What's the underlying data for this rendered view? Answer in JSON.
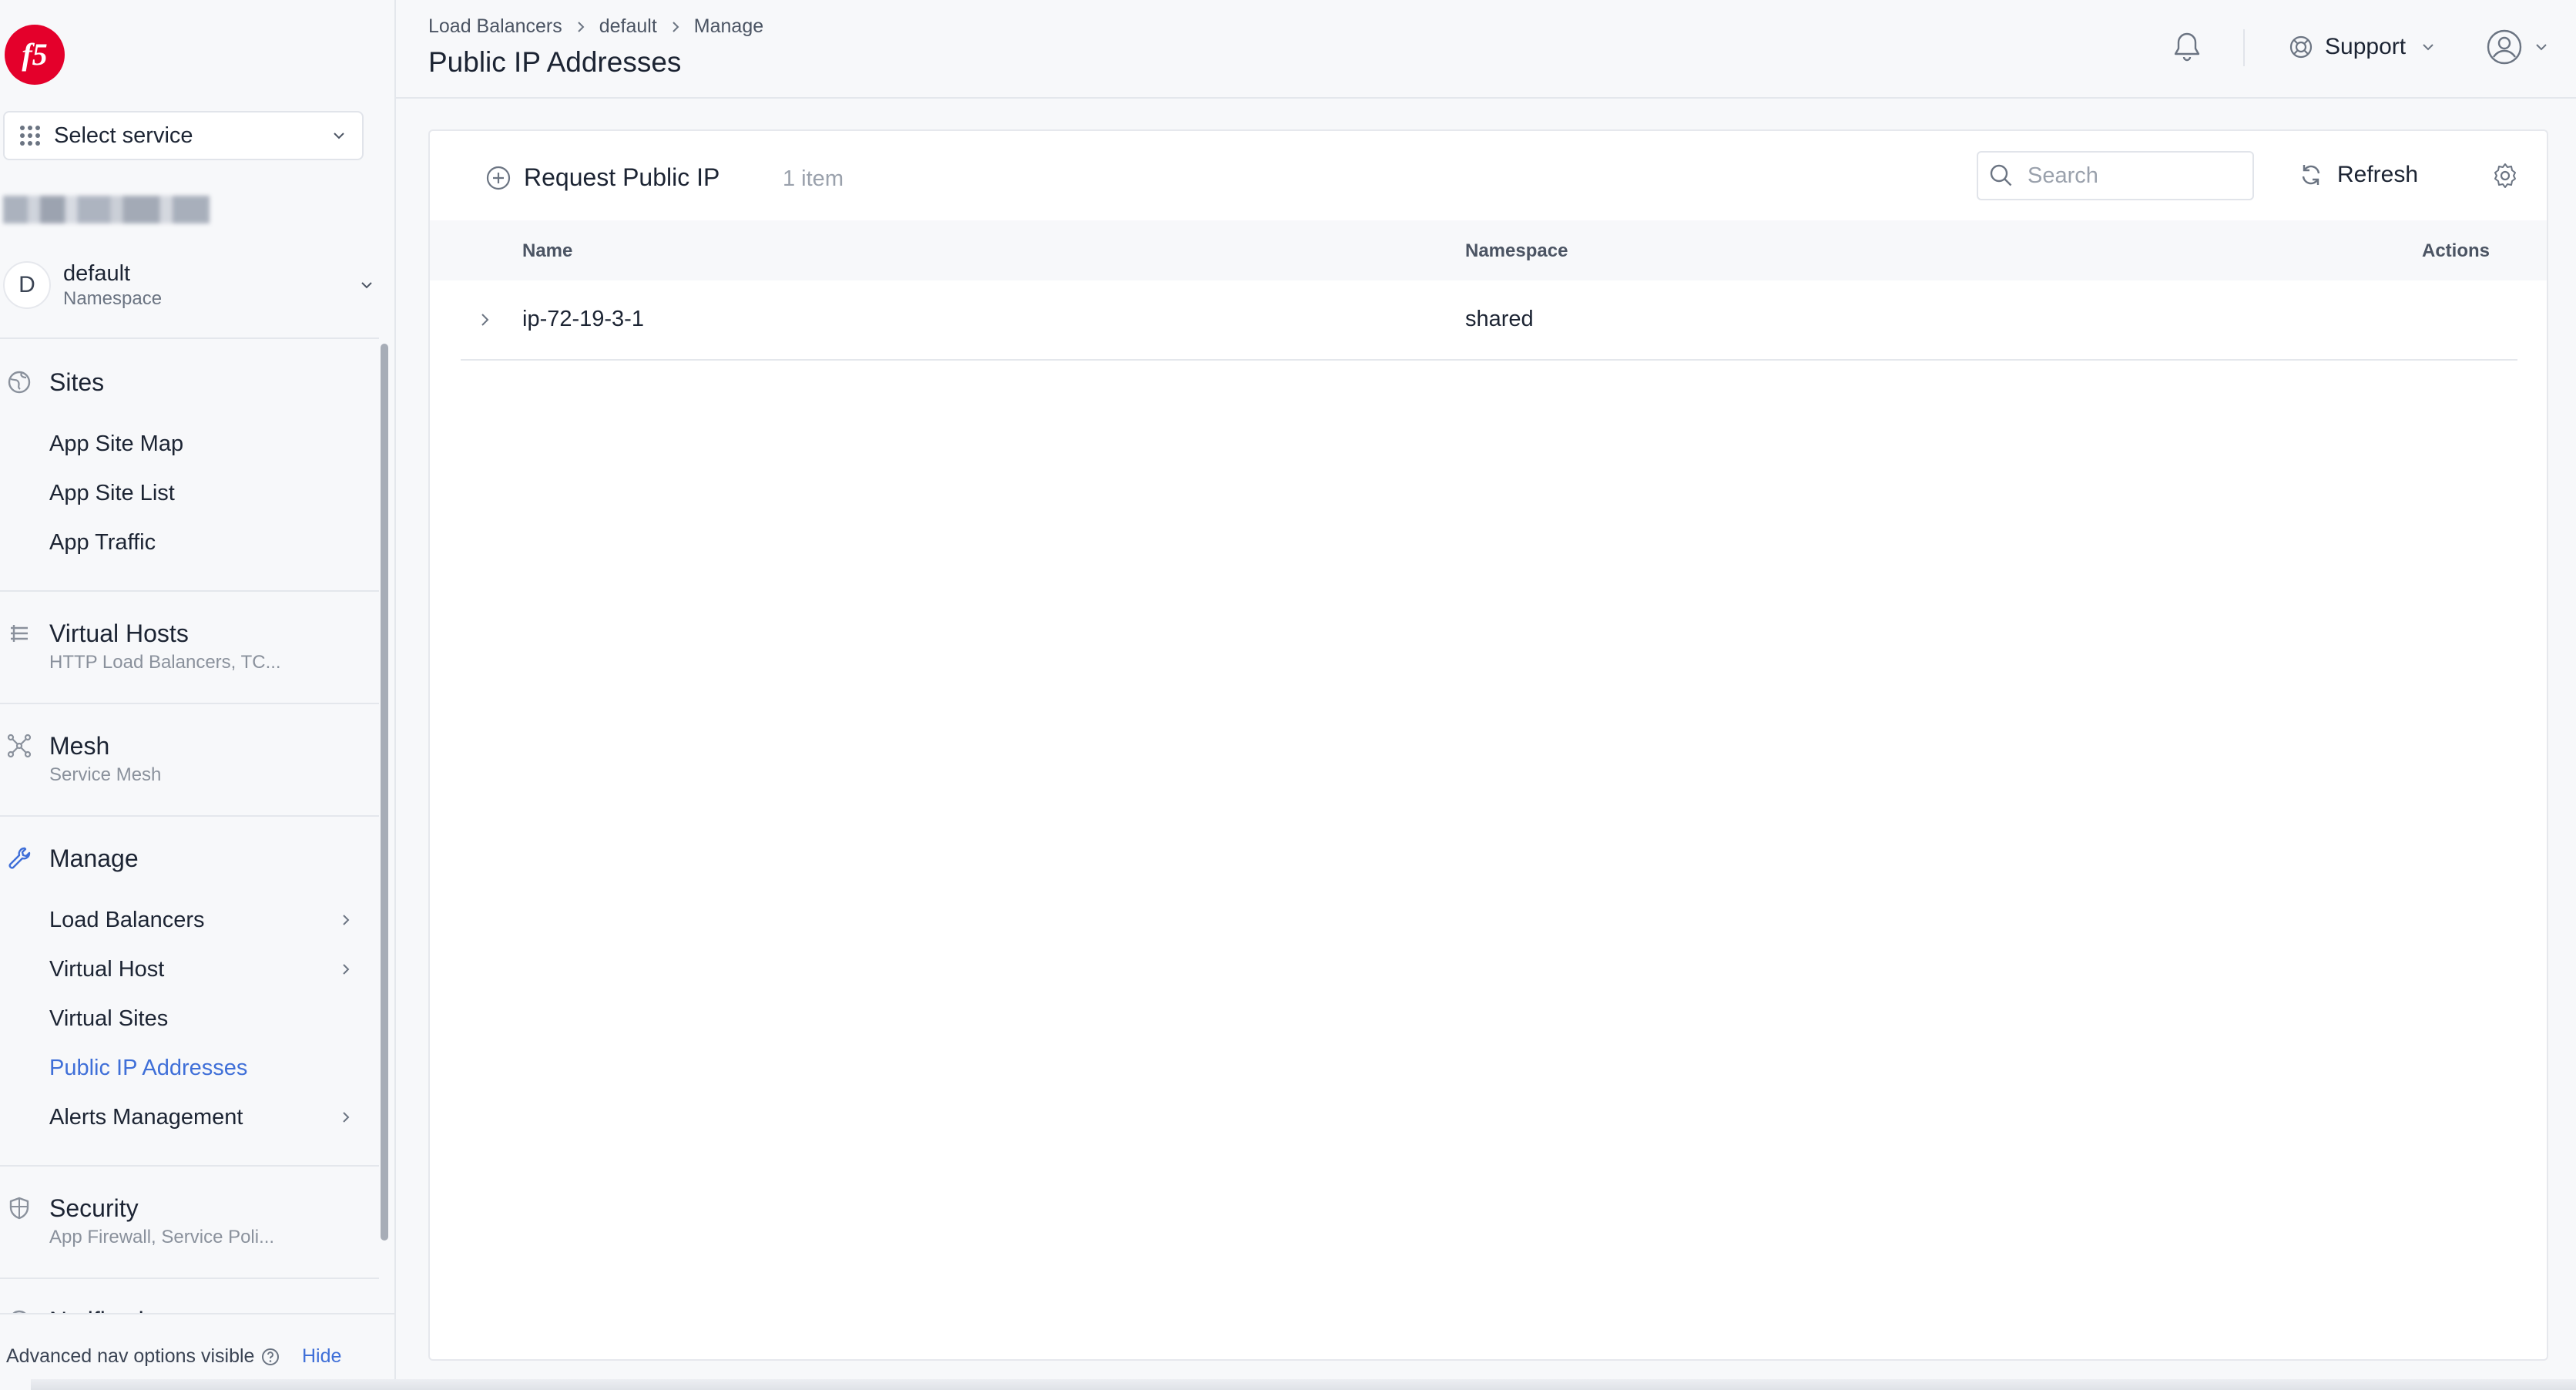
{
  "sidebar": {
    "service_select": {
      "label": "Select service"
    },
    "namespace": {
      "avatar_letter": "D",
      "name": "default",
      "caption": "Namespace"
    },
    "sections": {
      "sites": {
        "title": "Sites",
        "items": [
          "App Site Map",
          "App Site List",
          "App Traffic"
        ]
      },
      "virtual_hosts": {
        "title": "Virtual Hosts",
        "subtitle": "HTTP Load Balancers, TC..."
      },
      "mesh": {
        "title": "Mesh",
        "subtitle": "Service Mesh"
      },
      "manage": {
        "title": "Manage",
        "items": [
          "Load Balancers",
          "Virtual Host",
          "Virtual Sites",
          "Public IP Addresses",
          "Alerts Management"
        ],
        "active_item": "Public IP Addresses"
      },
      "security": {
        "title": "Security",
        "subtitle": "App Firewall, Service Poli..."
      },
      "notifications": {
        "title": "Notifications"
      }
    },
    "footer": {
      "text": "Advanced nav options visible",
      "hide_link": "Hide"
    }
  },
  "header": {
    "breadcrumb": [
      "Load Balancers",
      "default",
      "Manage"
    ],
    "title": "Public IP Addresses",
    "support_label": "Support"
  },
  "toolbar": {
    "request_label": "Request Public IP",
    "item_count": "1 item",
    "search_placeholder": "Search",
    "refresh_label": "Refresh"
  },
  "table": {
    "columns": {
      "name": "Name",
      "namespace": "Namespace",
      "actions": "Actions"
    },
    "rows": [
      {
        "name": "ip-72-19-3-1",
        "namespace": "shared"
      }
    ]
  },
  "colors": {
    "accent": "#3f6fd8",
    "brand_red": "#e4002b",
    "sidebar_bg": "#f7f8fa",
    "text_primary": "#1c2433"
  },
  "icons": {
    "logo": "f5-logo",
    "service_grid": "grid-dots-icon",
    "sites": "globe-icon",
    "virtual_hosts": "server-stack-icon",
    "mesh": "mesh-nodes-icon",
    "manage": "wrench-icon",
    "security": "shield-icon",
    "bell": "bell-icon",
    "support": "lifebuoy-icon",
    "user": "user-circle-icon",
    "search": "search-icon",
    "refresh": "refresh-icon",
    "settings": "gear-icon",
    "request": "plus-circle-icon"
  }
}
